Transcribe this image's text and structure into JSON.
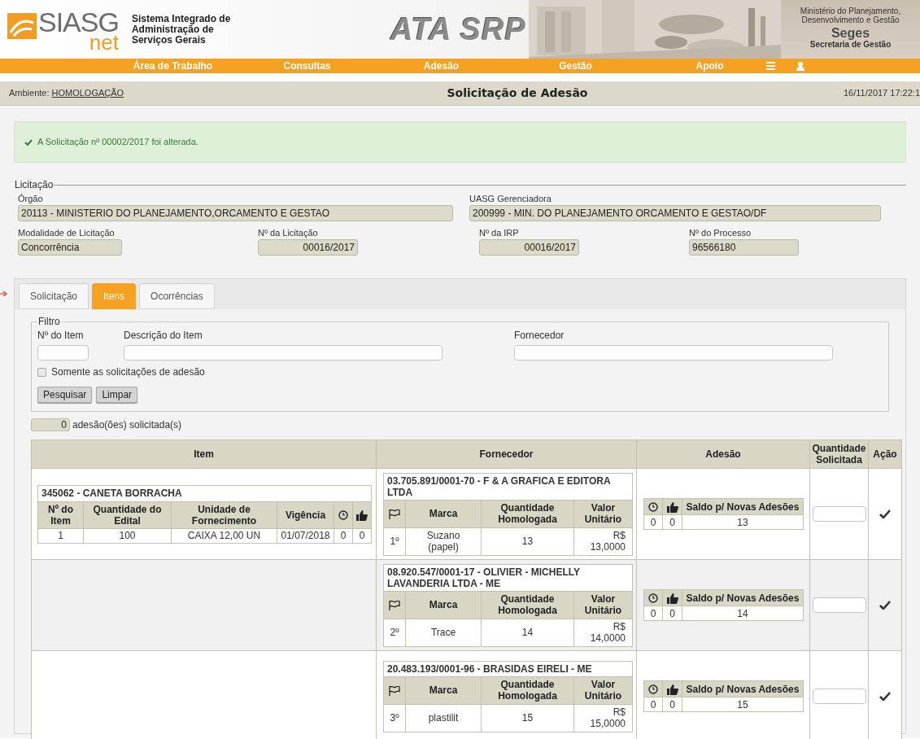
{
  "header": {
    "logo": {
      "main": "SIASG",
      "sub": "net"
    },
    "system_name": [
      "Sistema Integrado de",
      "Administração de",
      "Serviços Gerais"
    ],
    "app_title": "ATA SRP",
    "ministry": [
      "Ministério do Planejamento,",
      "Desenvolvimento e Gestão"
    ],
    "org": "Seges",
    "org_sub": "Secretaria de Gestão"
  },
  "nav": {
    "items": [
      "Área de Trabalho",
      "Consultas",
      "Adesão",
      "Gestão",
      "Apoio"
    ]
  },
  "subheader": {
    "ambiente_label": "Ambiente:",
    "ambiente": "HOMOLOGAÇÃO",
    "title": "Solicitação de Adesão",
    "datetime": "16/11/2017 17:22:1"
  },
  "alert": {
    "message": "A Solicitação nº 00002/2017 foi alterada."
  },
  "licitacao": {
    "legend": "Licitação",
    "fields": [
      {
        "label": "Órgão",
        "value": "20113 - MINISTERIO DO PLANEJAMENTO,ORCAMENTO E GESTAO"
      },
      {
        "label": "UASG Gerenciadora",
        "value": "200999 - MIN. DO PLANEJAMENTO ORCAMENTO E GESTAO/DF"
      },
      {
        "label": "Modalidade de Licitação",
        "value": "Concorrência"
      },
      {
        "label": "Nº da Licitação",
        "value": "00016/2017"
      },
      {
        "label": "Nº da IRP",
        "value": "00016/2017"
      },
      {
        "label": "Nº do Processo",
        "value": "96566180"
      }
    ]
  },
  "tabs": [
    {
      "label": "Solicitação",
      "selected": false
    },
    {
      "label": "Itens",
      "selected": true
    },
    {
      "label": "Ocorrências",
      "selected": false
    }
  ],
  "filter": {
    "legend": "Filtro",
    "fields": [
      {
        "label": "Nº do Item"
      },
      {
        "label": "Descrição do Item"
      },
      {
        "label": "Fornecedor"
      }
    ],
    "checkbox": {
      "label": "Somente as solicitações de adesão",
      "checked": false
    },
    "buttons": [
      "Pesquisar",
      "Limpar"
    ]
  },
  "count": {
    "value": "0",
    "label": "adesão(ões) solicitada(s)"
  },
  "table": {
    "columns": [
      "Item",
      "Fornecedor",
      "Adesão",
      "Quantidade Solicitada",
      "Ação"
    ],
    "item": {
      "title": "345062 - CANETA BORRACHA",
      "columns": [
        "Nº do Item",
        "Quantidade do Edital",
        "Unidade de Fornecimento",
        "Vigência"
      ],
      "values": [
        "1",
        "100",
        "CAIXA 12,00 UN",
        "01/07/2018",
        "0",
        "0"
      ]
    },
    "suppliers": [
      {
        "name": "03.705.891/0001-70 - F & A GRAFICA E EDITORA LTDA",
        "columns": [
          "Marca",
          "Quantidade Homologada",
          "Valor Unitário"
        ],
        "rank": "1º",
        "marca": "Suzano (papel)",
        "quantidade": "13",
        "valor": "R$ 13,0000",
        "adesao_column": "Saldo p/ Novas Adesões",
        "adesao_values": [
          "0",
          "0"
        ],
        "saldo": "13"
      },
      {
        "name": "08.920.547/0001-17 - OLIVIER - MICHELLY LAVANDERIA LTDA - ME",
        "columns": [
          "Marca",
          "Quantidade Homologada",
          "Valor Unitário"
        ],
        "rank": "2º",
        "marca": "Trace",
        "quantidade": "14",
        "valor": "R$ 14,0000",
        "adesao_column": "Saldo p/ Novas Adesões",
        "adesao_values": [
          "0",
          "0"
        ],
        "saldo": "14"
      },
      {
        "name": "20.483.193/0001-96 - BRASIDAS EIRELI - ME",
        "columns": [
          "Marca",
          "Quantidade Homologada",
          "Valor Unitário"
        ],
        "rank": "3º",
        "marca": "plastilit",
        "quantidade": "15",
        "valor": "R$ 15,0000",
        "adesao_column": "Saldo p/ Novas Adesões",
        "adesao_values": [
          "0",
          "0"
        ],
        "saldo": "15"
      }
    ]
  }
}
